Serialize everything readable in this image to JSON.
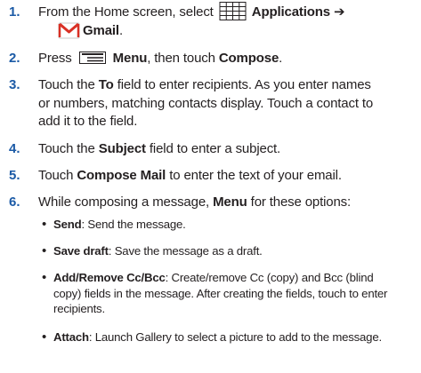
{
  "steps": [
    {
      "number": "1.",
      "t1": "From the Home screen, select",
      "b1": "Applications",
      "arrow": "➔",
      "icon_apps": "applications-grid-icon",
      "icon_gmail": "gmail-icon",
      "b2": "Gmail",
      "end": "."
    },
    {
      "number": "2.",
      "t1": "Press",
      "icon_menu": "menu-key-icon",
      "b1": "Menu",
      "t2": ", then touch",
      "b2": "Compose",
      "end": "."
    },
    {
      "number": "3.",
      "t1": "Touch the",
      "b1": "To",
      "t2": "field to enter recipients. As you enter names",
      "line2": "or numbers, matching contacts display. Touch a contact to",
      "line3": "add it to the field."
    },
    {
      "number": "4.",
      "t1": "Touch the",
      "b1": "Subject",
      "t2": "field to enter a subject."
    },
    {
      "number": "5.",
      "t1": "Touch",
      "b1": "Compose Mail",
      "t2": "to enter the text of your email."
    },
    {
      "number": "6.",
      "t1": "While composing a message,",
      "b1": "Menu",
      "t2": "for these options:"
    }
  ],
  "bullets": [
    {
      "bullet": "•",
      "label": "Send",
      "text": ": Send the message."
    },
    {
      "bullet": "•",
      "label": "Save draft",
      "text": ": Save the message as a draft."
    },
    {
      "bullet": "•",
      "label": "Add/Remove Cc/Bcc",
      "text": ": Create/remove Cc (copy) and Bcc (blind",
      "line2": "copy) fields in the message. After creating the fields, touch to enter",
      "line3": "recipients."
    },
    {
      "bullet": "•",
      "label": "Attach",
      "text": ": Launch Gallery to select a picture to add to the message."
    }
  ],
  "colors": {
    "step_number": "#1b5aa6",
    "text": "#231f20",
    "gmail_red": "#d93025"
  }
}
